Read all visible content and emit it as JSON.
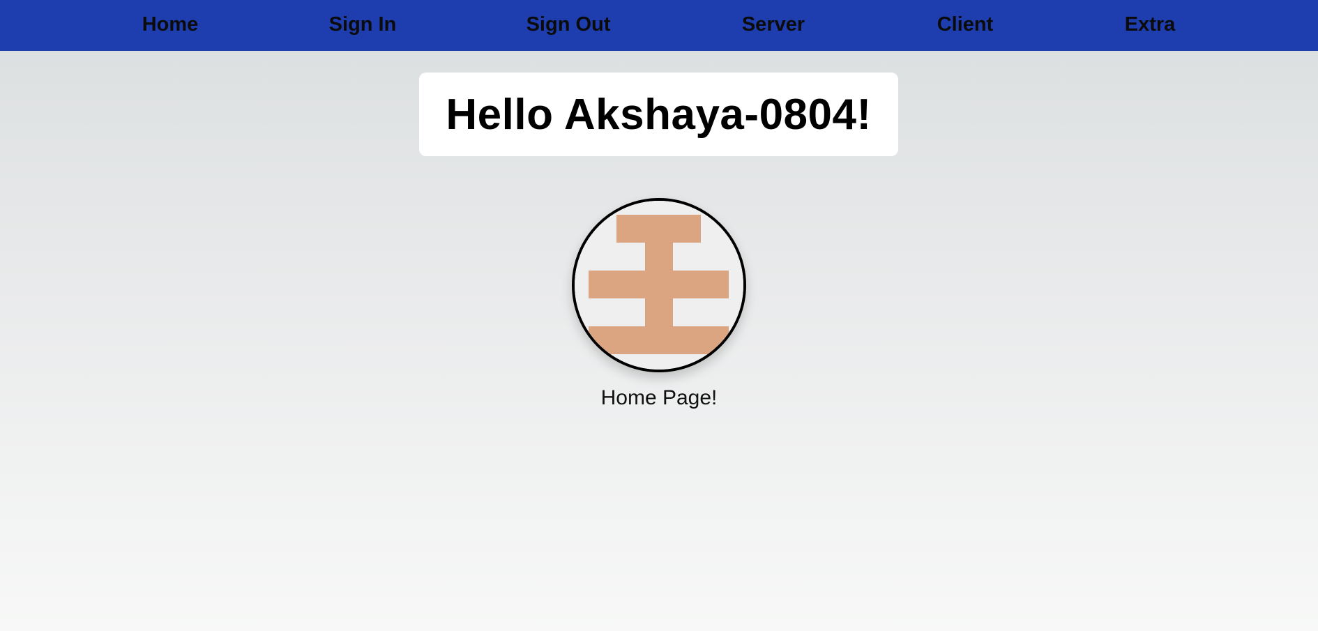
{
  "nav": {
    "items": [
      {
        "label": "Home"
      },
      {
        "label": "Sign In"
      },
      {
        "label": "Sign Out"
      },
      {
        "label": "Server"
      },
      {
        "label": "Client"
      },
      {
        "label": "Extra"
      }
    ]
  },
  "main": {
    "greeting": "Hello Akshaya-0804!",
    "avatar_icon": "identicon-avatar-icon",
    "page_label": "Home Page!"
  },
  "colors": {
    "navbar": "#1e3eb0",
    "identicon": "#dca582",
    "identicon_background": "#f0eff0"
  }
}
